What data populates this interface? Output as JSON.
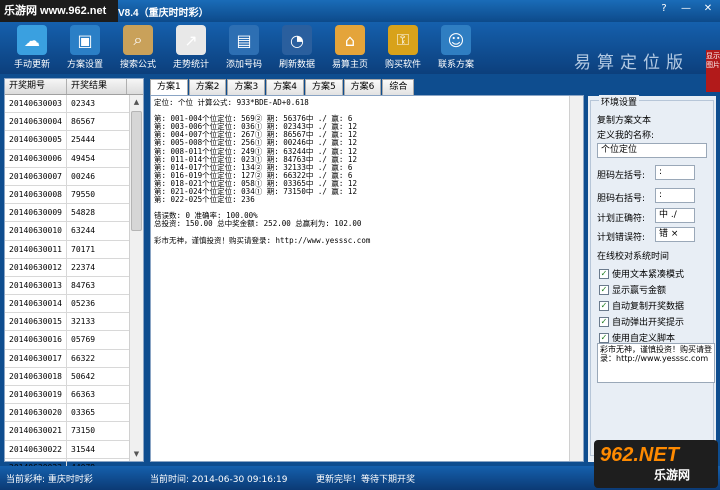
{
  "watermark_top": "乐游网 www.962.net",
  "window_title": "V8.4（重庆时时彩）",
  "window_buttons": {
    "help": "?",
    "minimize": "—",
    "close": "✕"
  },
  "toolbar": [
    {
      "label": "手动更新",
      "icon": "cloud-icon",
      "color": "#3aa0e0"
    },
    {
      "label": "方案设置",
      "icon": "monitor-icon",
      "color": "#2b7fc6"
    },
    {
      "label": "搜索公式",
      "icon": "search-formula-icon",
      "color": "#c9a15a"
    },
    {
      "label": "走势统计",
      "icon": "chart-icon",
      "color": "#e8e8e8"
    },
    {
      "label": "添加号码",
      "icon": "folder-add-icon",
      "color": "#2d6fb3"
    },
    {
      "label": "刷新数据",
      "icon": "gauge-icon",
      "color": "#2a5f9e"
    },
    {
      "label": "易算主页",
      "icon": "home-icon",
      "color": "#e4a43a"
    },
    {
      "label": "购买软件",
      "icon": "key-icon",
      "color": "#d8a21a"
    },
    {
      "label": "联系方案",
      "icon": "contacts-icon",
      "color": "#2f7ec2"
    }
  ],
  "brand_text": "易算定位版",
  "side_tag": "显示图片",
  "left_table": {
    "headers": [
      "开奖期号",
      "开奖结果"
    ],
    "rows": [
      [
        "20140630003",
        "02343"
      ],
      [
        "20140630004",
        "86567"
      ],
      [
        "20140630005",
        "25444"
      ],
      [
        "20140630006",
        "49454"
      ],
      [
        "20140630007",
        "00246"
      ],
      [
        "20140630008",
        "79550"
      ],
      [
        "20140630009",
        "54828"
      ],
      [
        "20140630010",
        "63244"
      ],
      [
        "20140630011",
        "70171"
      ],
      [
        "20140630012",
        "22374"
      ],
      [
        "20140630013",
        "84763"
      ],
      [
        "20140630014",
        "05236"
      ],
      [
        "20140630015",
        "32133"
      ],
      [
        "20140630016",
        "05769"
      ],
      [
        "20140630017",
        "66322"
      ],
      [
        "20140630018",
        "50642"
      ],
      [
        "20140630019",
        "66363"
      ],
      [
        "20140630020",
        "03365"
      ],
      [
        "20140630021",
        "73150"
      ],
      [
        "20140630022",
        "31544"
      ],
      [
        "20140630023",
        "44079"
      ],
      [
        "20140630024",
        ""
      ]
    ]
  },
  "tabs": [
    "方案1",
    "方案2",
    "方案3",
    "方案4",
    "方案5",
    "方案6",
    "综合"
  ],
  "main_text": "定位: 个位 计算公式: 933*BDE-AD+0.618\n\n第: 001-004个位定位: 569② 期: 56376中 ./ 赢: 6\n第: 003-006个位定位: 036① 期: 02343中 ./ 赢: 12\n第: 004-007个位定位: 267① 期: 86567中 ./ 赢: 12\n第: 005-008个位定位: 256① 期: 00246中 ./ 赢: 12\n第: 008-011个位定位: 249① 期: 63244中 ./ 赢: 12\n第: 011-014个位定位: 023① 期: 84763中 ./ 赢: 12\n第: 014-017个位定位: 134② 期: 32133中 ./ 赢: 6\n第: 016-019个位定位: 127② 期: 66322中 ./ 赢: 6\n第: 018-021个位定位: 058① 期: 03365中 ./ 赢: 12\n第: 021-024个位定位: 034① 期: 73150中 ./ 赢: 12\n第: 022-025个位定位: 236\n\n错误数: 0 准确率: 100.00%\n总投资: 150.00 总中奖金额: 252.00 总赢利为: 102.00\n\n彩市无神，谨慎投资！购买请登录: http://www.yesssc.com",
  "settings": {
    "group_title": "环境设置",
    "copy_scheme_text": "复制方案文本",
    "define_name_label": "定义我的名称:",
    "name_value": "个位定位",
    "left_bracket_label": "胆码左括号:",
    "left_bracket_value": ":",
    "right_bracket_label": "胆码右括号:",
    "right_bracket_value": ":",
    "correct_label": "计划正确符:",
    "correct_value": "中 ./",
    "error_label": "计划错误符:",
    "error_value": "错 ×",
    "online_time": "在线校对系统时间",
    "checks": [
      {
        "label": "使用文本紧凑模式",
        "checked": true
      },
      {
        "label": "显示赢亏金额",
        "checked": true
      },
      {
        "label": "自动复制开奖数据",
        "checked": true
      },
      {
        "label": "自动弹出开奖提示",
        "checked": true
      },
      {
        "label": "使用自定义脚本",
        "checked": true
      }
    ],
    "script_text": "彩市无神，谨慎投资！购买请登录：http://www.yesssc.com"
  },
  "status": {
    "lottery": "当前彩种: 重庆时时彩",
    "time": "当前时间: 2014-06-30 09:16:19",
    "update": "更新完毕！等待下期开奖"
  },
  "watermark_br": {
    "brand": "962.NET",
    "sub": "乐游网"
  }
}
